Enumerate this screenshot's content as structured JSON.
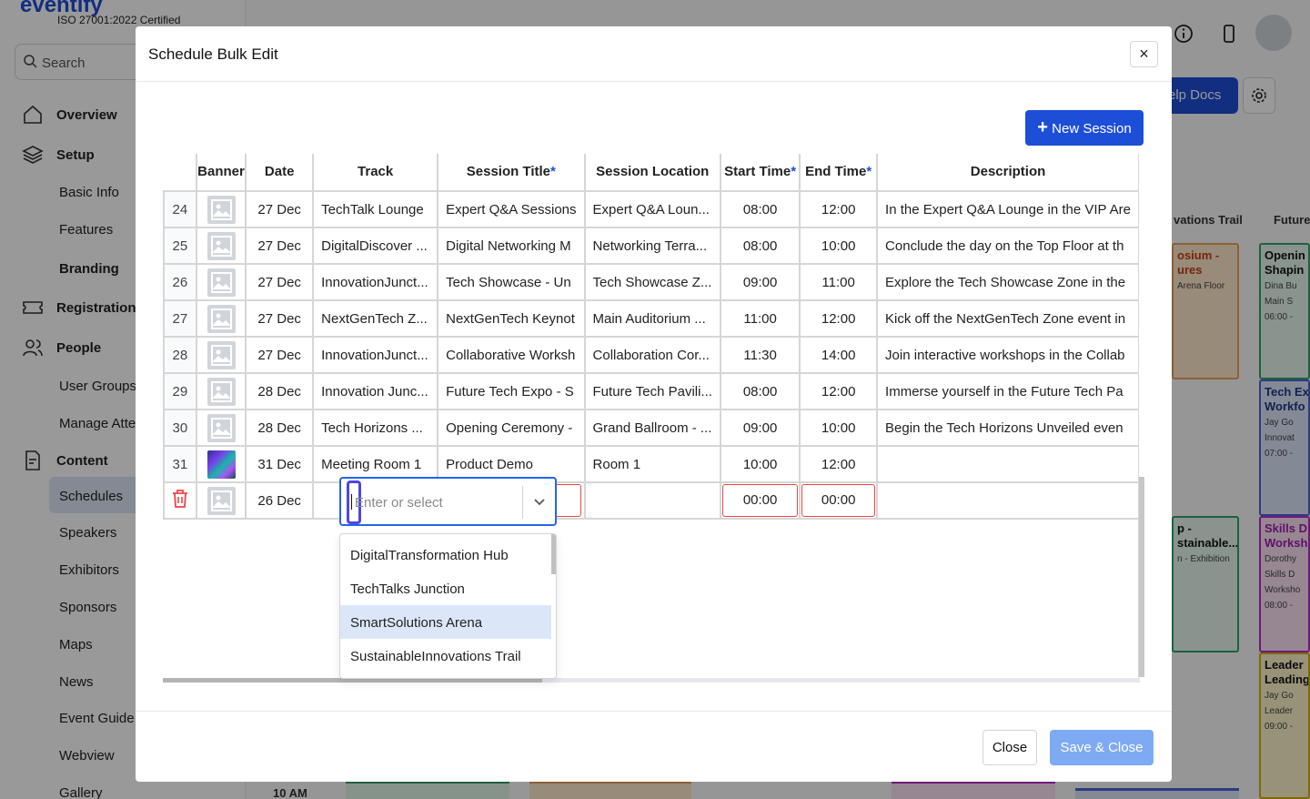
{
  "app": {
    "logo_text": "eventify",
    "certification": "ISO 27001:2022 Certified",
    "search_placeholder": "Search",
    "nav_main": [
      {
        "label": "Overview",
        "icon": "home-icon"
      },
      {
        "label": "Setup",
        "icon": "layers-icon"
      },
      {
        "label": "Registration",
        "icon": "ticket-icon"
      },
      {
        "label": "People",
        "icon": "people-icon"
      },
      {
        "label": "Content",
        "icon": "content-icon"
      }
    ],
    "nav_sub": {
      "basic_info": "Basic Info",
      "features": "Features",
      "branding": "Branding",
      "user_groups": "User Groups",
      "manage_attendees": "Manage Atte",
      "schedules": "Schedules",
      "speakers": "Speakers",
      "exhibitors": "Exhibitors",
      "sponsors": "Sponsors",
      "maps": "Maps",
      "news": "News",
      "event_guide": "Event Guide",
      "webview": "Webview",
      "gallery": "Gallery"
    },
    "help_docs": "elp Docs",
    "bg_columns": [
      "vations Trail",
      "Future"
    ],
    "bg_time": "10 AM",
    "bg_cards": [
      {
        "title": "osium -\nures",
        "sub1": "Arena Floor"
      },
      {
        "title": "Openin\nShapin",
        "sub1": "Dina Bu",
        "sub2": "Main S",
        "sub3": "06:00 -"
      },
      {
        "title": "Tech Ex\nWorkfo",
        "sub1": "Jay Go",
        "sub2": "Innovat",
        "sub3": "07:00 -"
      },
      {
        "title": "p -\nstainable...",
        "sub1": "n - Exhibition"
      },
      {
        "title": "Skills D\nWorksh",
        "sub1": "Dorothy",
        "sub2": "Skills D",
        "sub3": "Worksho",
        "sub4": "08:00 -"
      },
      {
        "title": "Leader\nLeading",
        "sub1": "Jay Go",
        "sub2": "Leader",
        "sub3": "09:00 -"
      }
    ]
  },
  "modal": {
    "title": "Schedule Bulk Edit",
    "close_x": "×",
    "new_session_label": "New Session",
    "new_session_plus": "+",
    "columns": {
      "banner": "Banner",
      "date": "Date",
      "track": "Track",
      "session_title": "Session Title",
      "session_location": "Session Location",
      "start_time": "Start Time",
      "end_time": "End Time",
      "description": "Description",
      "required_mark": "*"
    },
    "rows": [
      {
        "num": "24",
        "date": "27 Dec",
        "track": "TechTalk Lounge",
        "title": "Expert Q&A Sessions",
        "location": "Expert Q&A Loun...",
        "start": "08:00",
        "end": "12:00",
        "desc": "In the Expert Q&A Lounge in the VIP Are"
      },
      {
        "num": "25",
        "date": "27 Dec",
        "track": "DigitalDiscover ...",
        "title": "Digital Networking M",
        "location": "Networking Terra...",
        "start": "08:00",
        "end": "10:00",
        "desc": "Conclude the day on the Top Floor at th"
      },
      {
        "num": "26",
        "date": "27 Dec",
        "track": "InnovationJunct...",
        "title": "Tech Showcase - Un",
        "location": "Tech Showcase Z...",
        "start": "09:00",
        "end": "11:00",
        "desc": "Explore the Tech Showcase Zone in the"
      },
      {
        "num": "27",
        "date": "27 Dec",
        "track": "NextGenTech Z...",
        "title": "NextGenTech Keynot",
        "location": "Main Auditorium ...",
        "start": "11:00",
        "end": "12:00",
        "desc": "Kick off the NextGenTech Zone event in"
      },
      {
        "num": "28",
        "date": "27 Dec",
        "track": "InnovationJunct...",
        "title": "Collaborative Worksh",
        "location": "Collaboration Cor...",
        "start": "11:30",
        "end": "14:00",
        "desc": "Join interactive workshops in the Collab"
      },
      {
        "num": "29",
        "date": "28 Dec",
        "track": "Innovation Junc...",
        "title": "Future Tech Expo - S",
        "location": "Future Tech Pavili...",
        "start": "08:00",
        "end": "12:00",
        "desc": "Immerse yourself in the Future Tech Pa"
      },
      {
        "num": "30",
        "date": "28 Dec",
        "track": "Tech Horizons ...",
        "title": "Opening Ceremony -",
        "location": "Grand Ballroom - ...",
        "start": "09:00",
        "end": "10:00",
        "desc": "Begin the Tech Horizons Unveiled even"
      },
      {
        "num": "31",
        "date": "31 Dec",
        "track": "Meeting Room 1",
        "title": "Product Demo",
        "location": "Room 1",
        "start": "10:00",
        "end": "12:00",
        "desc": ""
      }
    ],
    "new_row": {
      "date": "26 Dec",
      "start": "00:00",
      "end": "00:00"
    },
    "track_input": {
      "placeholder": "Enter or select"
    },
    "track_options": [
      "DigitalTransformation Hub",
      "TechTalks Junction",
      "SmartSolutions Arena",
      "SustainableInnovations Trail"
    ],
    "close_label": "Close",
    "save_label": "Save & Close"
  }
}
